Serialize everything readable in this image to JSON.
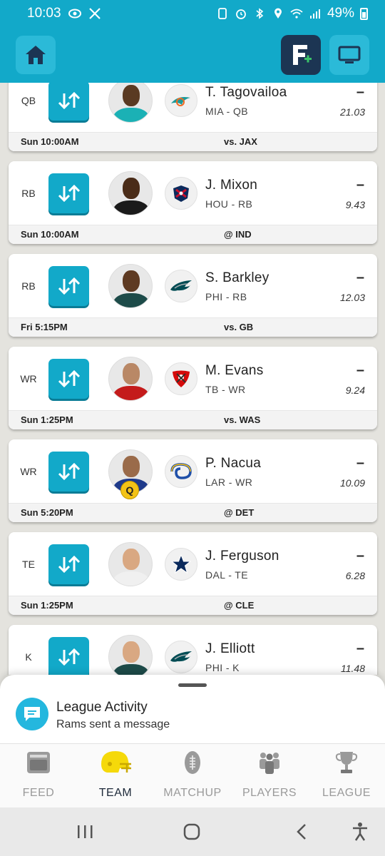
{
  "status_bar": {
    "time": "10:03",
    "battery": "49%"
  },
  "header": {
    "home_icon": "home-icon",
    "fantasy_icon": "fantasy-plus-icon",
    "tv_icon": "tv-icon"
  },
  "players": [
    {
      "position": "QB",
      "name": "T. Tagovailoa",
      "team": "MIA - QB",
      "score": "–",
      "projection": "21.03",
      "game_time": "Sun 10:00AM",
      "opponent": "vs. JAX",
      "jersey_color": "#1bb1b5",
      "skin": "#5a3a22",
      "logo_color": "#1b9a9a"
    },
    {
      "position": "RB",
      "name": "J. Mixon",
      "team": "HOU - RB",
      "score": "–",
      "projection": "9.43",
      "game_time": "Sun 10:00AM",
      "opponent": "@ IND",
      "jersey_color": "#1a1a1a",
      "skin": "#4a2c18",
      "logo_color": "#c8102e"
    },
    {
      "position": "RB",
      "name": "S. Barkley",
      "team": "PHI - RB",
      "score": "–",
      "projection": "12.03",
      "game_time": "Fri 5:15PM",
      "opponent": "vs. GB",
      "jersey_color": "#1d4b49",
      "skin": "#5e3a22",
      "logo_color": "#004c54"
    },
    {
      "position": "WR",
      "name": "M. Evans",
      "team": "TB - WR",
      "score": "–",
      "projection": "9.24",
      "game_time": "Sun 1:25PM",
      "opponent": "vs. WAS",
      "jersey_color": "#c41b1b",
      "skin": "#b98866",
      "logo_color": "#d50a0a"
    },
    {
      "position": "WR",
      "name": "P. Nacua",
      "team": "LAR - WR",
      "score": "–",
      "projection": "10.09",
      "game_time": "Sun 5:20PM",
      "opponent": "@ DET",
      "jersey_color": "#1e3a8a",
      "skin": "#9a6b4a",
      "logo_color": "#1e4fa8",
      "injury": "Q"
    },
    {
      "position": "TE",
      "name": "J. Ferguson",
      "team": "DAL - TE",
      "score": "–",
      "projection": "6.28",
      "game_time": "Sun 1:25PM",
      "opponent": "@ CLE",
      "jersey_color": "#f0f0f0",
      "skin": "#d9a882",
      "logo_color": "#0b2a5c"
    },
    {
      "position": "K",
      "name": "J. Elliott",
      "team": "PHI - K",
      "score": "–",
      "projection": "11.48",
      "game_time": "",
      "opponent": "",
      "jersey_color": "#1d4b49",
      "skin": "#d9a882",
      "logo_color": "#004c54"
    }
  ],
  "league_activity": {
    "title": "League Activity",
    "message": "Rams sent a message"
  },
  "tabs": [
    {
      "label": "FEED",
      "icon": "feed-icon",
      "active": false
    },
    {
      "label": "TEAM",
      "icon": "helmet-icon",
      "active": true
    },
    {
      "label": "MATCHUP",
      "icon": "football-icon",
      "active": false
    },
    {
      "label": "PLAYERS",
      "icon": "players-icon",
      "active": false
    },
    {
      "label": "LEAGUE",
      "icon": "trophy-icon",
      "active": false
    }
  ],
  "colors": {
    "accent": "#12a9c9",
    "navy": "#1c3553",
    "helmet": "#f5d90a"
  }
}
